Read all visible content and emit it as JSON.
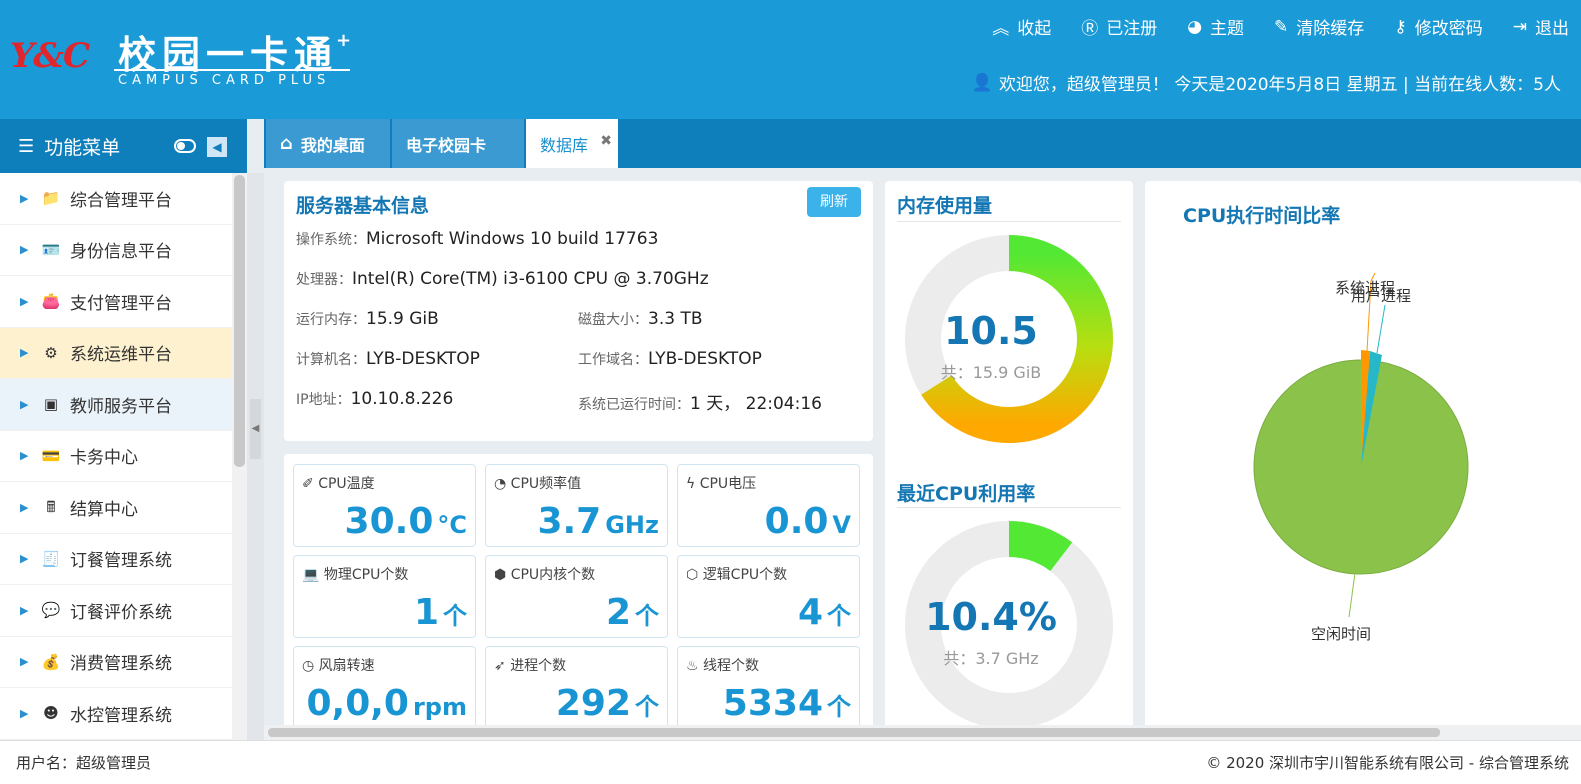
{
  "header": {
    "logo_mark": "Y&C",
    "logo_title": "校园一卡通",
    "logo_plus": "+",
    "logo_sub": "CAMPUS CARD PLUS",
    "links": [
      {
        "icon": "chevron-up-double-icon",
        "glyph": "︽",
        "label": "收起"
      },
      {
        "icon": "registered-icon",
        "glyph": "Ⓡ",
        "label": "已注册"
      },
      {
        "icon": "palette-icon",
        "glyph": "◕",
        "label": "主题"
      },
      {
        "icon": "eraser-icon",
        "glyph": "✎",
        "label": "清除缓存"
      },
      {
        "icon": "key-icon",
        "glyph": "⚷",
        "label": "修改密码"
      },
      {
        "icon": "logout-icon",
        "glyph": "⇥",
        "label": "退出"
      }
    ],
    "welcome": "欢迎您，超级管理员！ 今天是2020年5月8日 星期五 | 当前在线人数：5人"
  },
  "sidebar": {
    "title": "功能菜单",
    "items": [
      {
        "label": "综合管理平台",
        "icon": "folder-icon",
        "glyph": "📁"
      },
      {
        "label": "身份信息平台",
        "icon": "id-card-icon",
        "glyph": "🪪"
      },
      {
        "label": "支付管理平台",
        "icon": "wallet-icon",
        "glyph": "👛"
      },
      {
        "label": "系统运维平台",
        "icon": "settings-window-icon",
        "glyph": "⚙"
      },
      {
        "label": "教师服务平台",
        "icon": "teacher-board-icon",
        "glyph": "▣"
      },
      {
        "label": "卡务中心",
        "icon": "card-icon",
        "glyph": "💳"
      },
      {
        "label": "结算中心",
        "icon": "calculator-icon",
        "glyph": "🖩"
      },
      {
        "label": "订餐管理系统",
        "icon": "order-icon",
        "glyph": "🧾"
      },
      {
        "label": "订餐评价系统",
        "icon": "comment-icon",
        "glyph": "💬"
      },
      {
        "label": "消费管理系统",
        "icon": "purse-icon",
        "glyph": "💰"
      },
      {
        "label": "水控管理系统",
        "icon": "water-icon",
        "glyph": "☻"
      }
    ]
  },
  "tabs": [
    {
      "label": "我的桌面"
    },
    {
      "label": "电子校园卡"
    },
    {
      "label": "数据库",
      "close": "✖"
    }
  ],
  "server_info": {
    "title": "服务器基本信息",
    "refresh": "刷新",
    "os_label": "操作系统：",
    "os": "Microsoft Windows 10 build 17763",
    "cpu_label": "处理器：",
    "cpu": "Intel(R) Core(TM) i3-6100 CPU @ 3.70GHz",
    "ram_label": "运行内存：",
    "ram": "15.9 GiB",
    "disk_label": "磁盘大小：",
    "disk": "3.3 TB",
    "host_label": "计算机名：",
    "host": "LYB-DESKTOP",
    "domain_label": "工作域名：",
    "domain": "LYB-DESKTOP",
    "ip_label": "IP地址：",
    "ip": "10.10.8.226",
    "uptime_label": "系统已运行时间：",
    "uptime": "1 天， 22:04:16"
  },
  "metrics": [
    {
      "icon": "wand-icon",
      "glyph": "✐",
      "label": "CPU温度",
      "value": "30.0",
      "unit": "°C"
    },
    {
      "icon": "speedometer-icon",
      "glyph": "◔",
      "label": "CPU频率值",
      "value": "3.7",
      "unit": "GHz"
    },
    {
      "icon": "bolt-icon",
      "glyph": "ϟ",
      "label": "CPU电压",
      "value": "0.0",
      "unit": "V"
    },
    {
      "icon": "laptop-icon",
      "glyph": "💻",
      "label": "物理CPU个数",
      "value": "1",
      "unit": "个"
    },
    {
      "icon": "cube-icon",
      "glyph": "⬢",
      "label": "CPU内核个数",
      "value": "2",
      "unit": "个"
    },
    {
      "icon": "cubes-icon",
      "glyph": "⬡",
      "label": "逻辑CPU个数",
      "value": "4",
      "unit": "个"
    },
    {
      "icon": "clock-icon",
      "glyph": "◷",
      "label": "风扇转速",
      "value": "0,0,0",
      "unit": "rpm"
    },
    {
      "icon": "rocket-icon",
      "glyph": "➶",
      "label": "进程个数",
      "value": "292",
      "unit": "个"
    },
    {
      "icon": "fire-icon",
      "glyph": "♨",
      "label": "线程个数",
      "value": "5334",
      "unit": "个"
    }
  ],
  "memory": {
    "title": "内存使用量",
    "value": "10.5",
    "total": "共：15.9 GiB",
    "fraction": 0.66
  },
  "cpu_usage": {
    "title": "最近CPU利用率",
    "value": "10.4%",
    "total": "共：3.7 GHz",
    "fraction": 0.104
  },
  "cpu_time": {
    "title": "CPU执行时间比率",
    "labels": {
      "system": "系统进程",
      "user": "用户进程",
      "idle": "空闲时间"
    }
  },
  "colors": {
    "header": "#1a9ad6",
    "nav": "#0f7fbc",
    "accent": "#1477b4",
    "metric": "#1a95d3"
  },
  "footer": {
    "user": "用户名：超级管理员",
    "copyright": "© 2020 深圳市宇川智能系统有限公司 - 综合管理系统"
  }
}
